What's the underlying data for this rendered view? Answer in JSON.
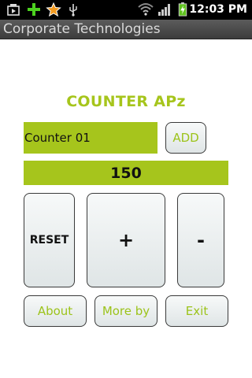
{
  "status_bar": {
    "time": "12:03 PM",
    "icons": [
      "media-notification-icon",
      "add-notification-icon",
      "star-notification-icon",
      "usb-icon",
      "wifi-icon",
      "signal-icon",
      "battery-charging-icon"
    ]
  },
  "title_bar": {
    "title": "Corporate Technologies"
  },
  "main": {
    "app_title": "COUNTER APz",
    "counter_name": "Counter 01",
    "add_label": "ADD",
    "count_value": "150",
    "reset_label": "RESET",
    "plus_label": "+",
    "minus_label": "-",
    "about_label": "About",
    "more_label": "More by",
    "exit_label": "Exit"
  },
  "colors": {
    "accent": "#a6c51c",
    "title_bar_bg": "#4a4a4a",
    "status_bar_bg": "#000000"
  }
}
